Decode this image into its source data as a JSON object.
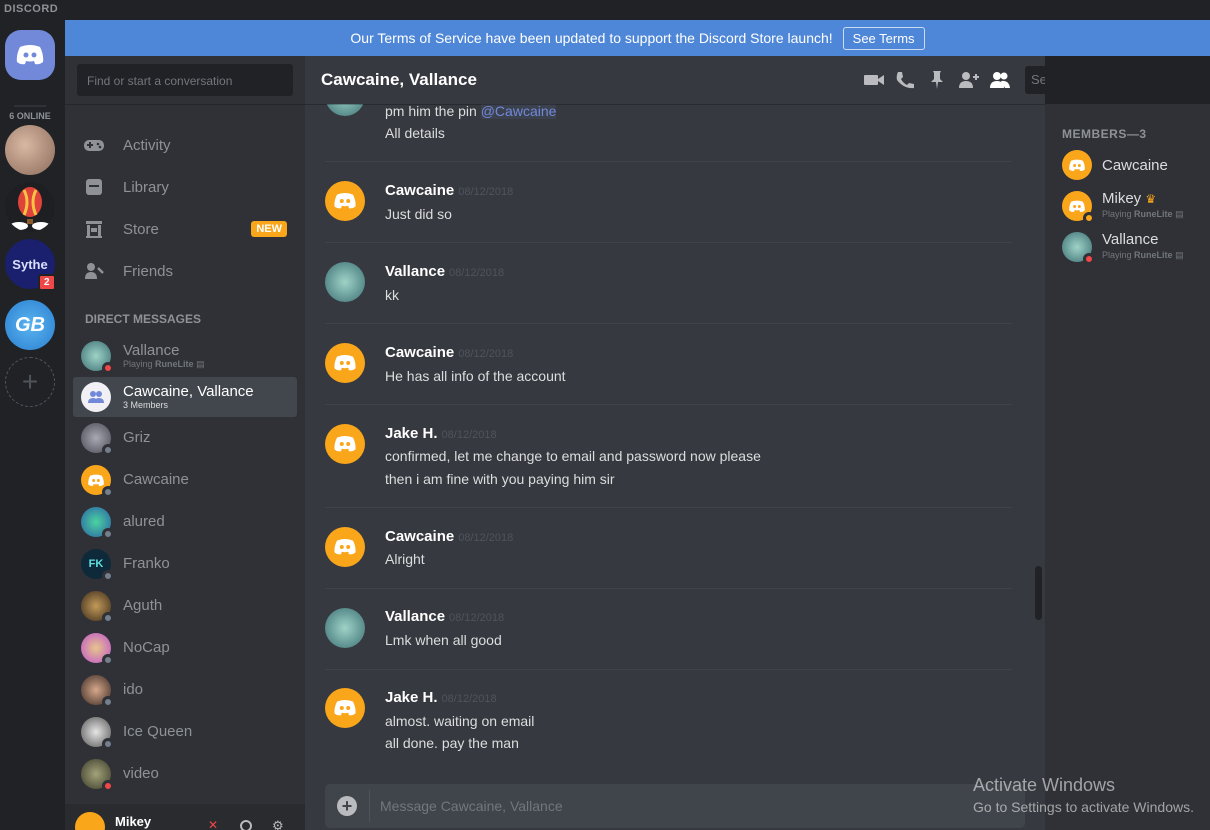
{
  "app": {
    "brand": "DISCORD",
    "online_count": "6 ONLINE"
  },
  "banner": {
    "text": "Our Terms of Service have been updated to support the Discord Store launch!",
    "button": "See Terms"
  },
  "servers": [
    {
      "name": "server-avatar-1"
    },
    {
      "name": "server-avatar-balloon"
    },
    {
      "name": "server-sythe",
      "label": "Sythe",
      "badge": "2"
    },
    {
      "name": "server-gb",
      "label": "GB"
    }
  ],
  "sidebar": {
    "search_placeholder": "Find or start a conversation",
    "nav": [
      {
        "label": "Activity"
      },
      {
        "label": "Library"
      },
      {
        "label": "Store",
        "tag": "NEW"
      },
      {
        "label": "Friends"
      }
    ],
    "dm_header": "Direct Messages",
    "dms": [
      {
        "name": "Vallance",
        "sub_prefix": "Playing",
        "sub_game": "RuneLite",
        "status": "dnd"
      },
      {
        "name": "Cawcaine, Vallance",
        "sub": "3 Members",
        "active": true
      },
      {
        "name": "Griz",
        "status": "offline"
      },
      {
        "name": "Cawcaine",
        "status": "offline"
      },
      {
        "name": "alured",
        "status": "offline"
      },
      {
        "name": "Franko",
        "status": "offline"
      },
      {
        "name": "Aguth",
        "status": "offline"
      },
      {
        "name": "NoCap",
        "status": "offline"
      },
      {
        "name": "ido",
        "status": "offline"
      },
      {
        "name": "Ice Queen",
        "status": "offline"
      },
      {
        "name": "video",
        "status": "dnd"
      }
    ],
    "user": {
      "name": "Mikey"
    }
  },
  "chat": {
    "title": "Cawcaine, Vallance",
    "search_placeholder": "Search",
    "composer_placeholder": "Message Cawcaine, Vallance",
    "messages": [
      {
        "author": "",
        "date": "",
        "lines": [
          "pm him the pin",
          "All details"
        ],
        "mention": "@Cawcaine"
      },
      {
        "author": "Cawcaine",
        "date": "08/12/2018",
        "lines": [
          "Just did so"
        ]
      },
      {
        "author": "Vallance",
        "date": "08/12/2018",
        "lines": [
          "kk"
        ]
      },
      {
        "author": "Cawcaine",
        "date": "08/12/2018",
        "lines": [
          "He has all info of the account"
        ]
      },
      {
        "author": "Jake H.",
        "date": "08/12/2018",
        "lines": [
          "confirmed, let me change to email and password now please",
          "then i am fine with you paying him sir"
        ]
      },
      {
        "author": "Cawcaine",
        "date": "08/12/2018",
        "lines": [
          "Alright"
        ]
      },
      {
        "author": "Vallance",
        "date": "08/12/2018",
        "lines": [
          "Lmk when all good"
        ]
      },
      {
        "author": "Jake H.",
        "date": "08/12/2018",
        "lines": [
          "almost. waiting on email",
          "all done. pay the man"
        ]
      }
    ]
  },
  "members": {
    "header": "MEMBERS—3",
    "list": [
      {
        "name": "Cawcaine"
      },
      {
        "name": "Mikey",
        "crown": "♛",
        "sub_prefix": "Playing",
        "sub_game": "RuneLite",
        "status": "idle"
      },
      {
        "name": "Vallance",
        "sub_prefix": "Playing",
        "sub_game": "RuneLite",
        "status": "dnd"
      }
    ]
  },
  "watermark": {
    "line1": "Activate Windows",
    "line2": "Go to Settings to activate Windows."
  },
  "colors": {
    "blurple": "#7289da",
    "banner": "#4f87d8",
    "orange_avatar": "#faa61a",
    "dnd": "#f04747",
    "idle": "#faa61a",
    "offline": "#747f8d",
    "new_tag": "#faa61a"
  }
}
